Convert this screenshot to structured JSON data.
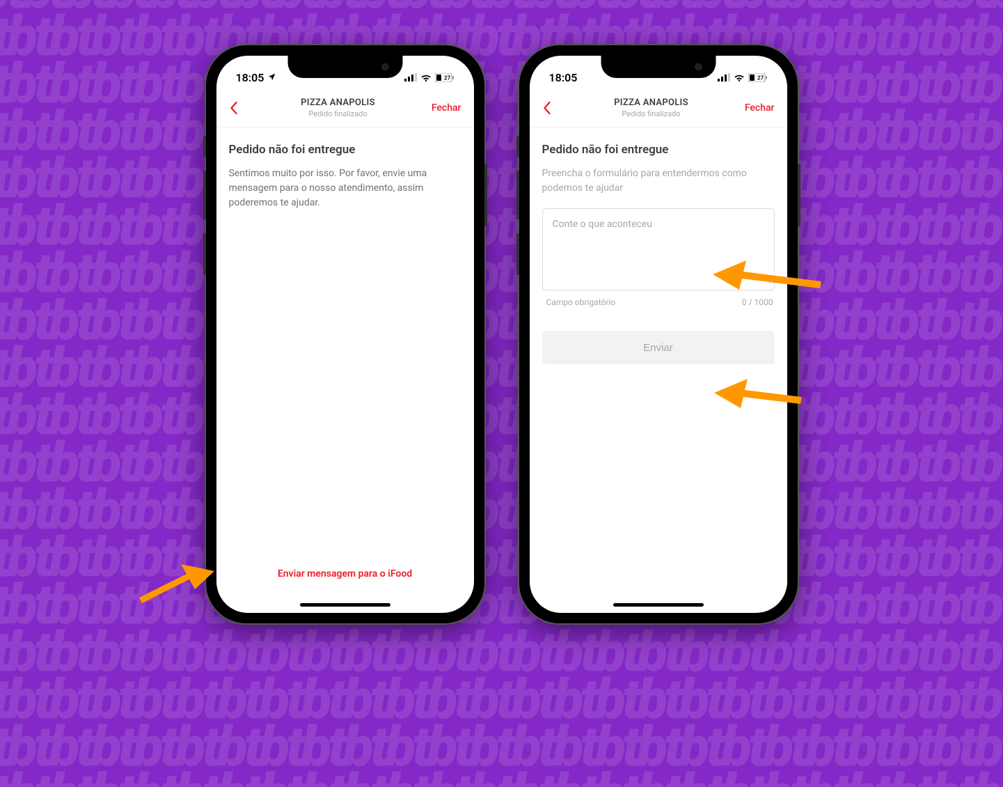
{
  "status": {
    "time": "18:05",
    "battery_level": "27"
  },
  "colors": {
    "accent": "#ea1d2c",
    "background": "#8428c7",
    "arrow": "#ff9800"
  },
  "nav": {
    "title": "PIZZA ANAPOLIS",
    "subtitle": "Pedido finalizado",
    "close_label": "Fechar"
  },
  "screen1": {
    "heading": "Pedido não foi entregue",
    "body": "Sentimos muito por isso. Por favor, envie uma mensagem para o nosso atendimento, assim poderemos te ajudar.",
    "cta": "Enviar mensagem para o iFood"
  },
  "screen2": {
    "heading": "Pedido não foi entregue",
    "help": "Preencha o formulário para entendermos como podemos te ajudar",
    "placeholder": "Conte o que aconteceu",
    "required_label": "Campo obrigatório",
    "counter": "0 / 1000",
    "submit_label": "Enviar"
  }
}
